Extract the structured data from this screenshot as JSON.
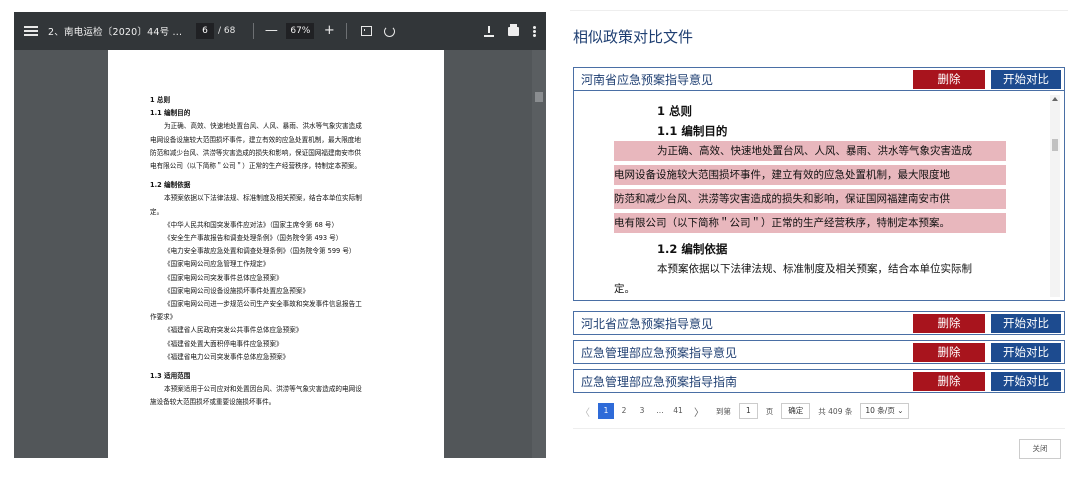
{
  "viewer": {
    "doc_title": "2、南电运检〔2020〕44号 ...",
    "page_current": "6",
    "page_total": "/ 68",
    "zoom_minus": "—",
    "zoom": "67%",
    "zoom_plus": "+",
    "page_content": {
      "h1": "1 总则",
      "s1_title": "1.1 编制目的",
      "s1_lines": [
        "为正确、高效、快速地处置台风、人风、暴雨、洪水等气象灾害造成",
        "电网设备设施较大范围损坏事件，建立有效的应急处置机制，最大限度地",
        "防范和减少台风、洪涝等灾害造成的损失和影响，保证国网福建南安市供",
        "电有限公司（以下简称＂公司＂）正常的生产经营秩序，特制定本预案。"
      ],
      "s2_title": "1.2 编制依据",
      "s2_lines": [
        "本预案依据以下法律法规、标准制度及相关预案，结合本单位实际制",
        "定。"
      ],
      "refs": [
        "《中华人民共和国突发事件应对法》（国家主席令第 68 号）",
        "《安全生产事故报告和调查处理条例》（国务院令第 493 号）",
        "《电力安全事故应急处置和调查处理条例》（国务院令第 599 号）",
        "《国家电网公司应急管理工作规定》",
        "《国家电网公司突发事件总体应急预案》",
        "《国家电网公司设备设施损坏事件处置应急预案》",
        "《国家电网公司进一步规范公司生产安全事故和突发事件信息报告工"
      ],
      "ref_cont": "作要求》",
      "refs2": [
        "《福建省人民政府突发公共事件总体应急预案》",
        "《福建省处置大面积停电事件应急预案》",
        "《福建省电力公司突发事件总体应急预案》"
      ],
      "s3_title": "1.3 适用范围",
      "s3_lines": [
        "本预案适用于公司应对和处置因台风、洪涝等气象灾害造成的电网设",
        "施设备较大范围损坏或重要设施损坏事件。"
      ]
    }
  },
  "panel": {
    "title": "相似政策对比文件",
    "delete_label": "删除",
    "compare_label": "开始对比",
    "items": [
      {
        "label": "河南省应急预案指导意见"
      },
      {
        "label": "河北省应急预案指导意见"
      },
      {
        "label": "应急管理部应急预案指导意见"
      },
      {
        "label": "应急管理部应急预案指导指南"
      }
    ],
    "preview": {
      "h1": "1 总则",
      "h2": "1.1 编制目的",
      "hl_lines": [
        "为正确、高效、快速地处置台风、人风、暴雨、洪水等气象灾害造成",
        "电网设备设施较大范围损坏事件，建立有效的应急处置机制，最大限度地",
        "防范和减少台风、洪涝等灾害造成的损失和影响，保证国网福建南安市供",
        "电有限公司（以下简称＂公司＂）正常的生产经营秩序，特制定本预案。"
      ],
      "h3": "1.2 编制依据",
      "plain_lines": [
        "本预案依据以下法律法规、标准制度及相关预案，结合本单位实际制",
        "定。"
      ]
    },
    "pager": {
      "prev": "〈",
      "pages": [
        "1",
        "2",
        "3",
        "...",
        "41"
      ],
      "next": "〉",
      "goto_label": "到第",
      "goto_value": "1",
      "page_unit": "页",
      "confirm": "确定",
      "total": "共 409 条",
      "page_size": "10 条/页 ⌄"
    },
    "close_label": "关闭"
  }
}
